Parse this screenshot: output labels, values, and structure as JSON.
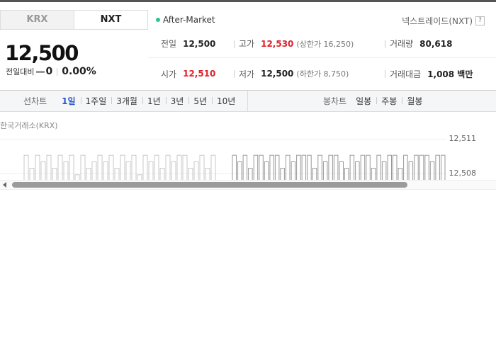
{
  "market_tabs": {
    "krx": "KRX",
    "nxt": "NXT"
  },
  "session": "After-Market",
  "exchange_name": "넥스트레이드(NXT)",
  "help_icon": "?",
  "quote": {
    "price": "12,500",
    "change_label": "전일대비",
    "change_value": "0",
    "change_pct": "0.00%"
  },
  "stats": {
    "prev_close": {
      "label": "전일",
      "value": "12,500"
    },
    "high": {
      "label": "고가",
      "value": "12,530",
      "limit": "(상한가 16,250)"
    },
    "volume": {
      "label": "거래량",
      "value": "80,618"
    },
    "open": {
      "label": "시가",
      "value": "12,510"
    },
    "low": {
      "label": "저가",
      "value": "12,500",
      "limit": "(하한가 8,750)"
    },
    "turnover": {
      "label": "거래대금",
      "value": "1,008 백만"
    }
  },
  "chart_toolbar": {
    "line_title": "선차트",
    "line_periods": [
      "1일",
      "1주일",
      "3개월",
      "1년",
      "3년",
      "5년",
      "10년"
    ],
    "line_active": "1일",
    "candle_title": "봉차트",
    "candle_periods": [
      "일봉",
      "주봉",
      "월봉"
    ]
  },
  "chart_source": "한국거래소(KRX)",
  "colors": {
    "up": "#e0202a",
    "gray": "#c8c8c8",
    "accent": "#2a56c6"
  },
  "chart_data": {
    "type": "bar",
    "title": "",
    "ylabels": [
      "12,511",
      "12,508"
    ],
    "ylim": [
      12507,
      12512
    ],
    "series": [
      {
        "color": "gray",
        "values": [
          12511,
          12509,
          12511,
          12510,
          12511,
          12509,
          12511,
          12510,
          12511,
          12508,
          12511,
          12509,
          12510,
          12511,
          12510,
          12511,
          12509,
          12511,
          12510,
          12511,
          12508,
          12511,
          12510,
          12511,
          12509,
          12511,
          12510,
          12511,
          12511,
          12509,
          12510,
          12511,
          12509,
          12511
        ]
      },
      {
        "color": "red",
        "values": [
          12511,
          12510,
          12511,
          12509,
          12511,
          12511,
          12510,
          12511,
          12511,
          12509,
          12511,
          12510,
          12511,
          12511,
          12511,
          12509,
          12511,
          12510,
          12511,
          12511,
          12510,
          12509,
          12511,
          12510,
          12511,
          12511,
          12509,
          12511,
          12510,
          12511,
          12511,
          12509,
          12511,
          12510,
          12511,
          12511,
          12511,
          12510,
          12511,
          12511
        ]
      }
    ]
  }
}
